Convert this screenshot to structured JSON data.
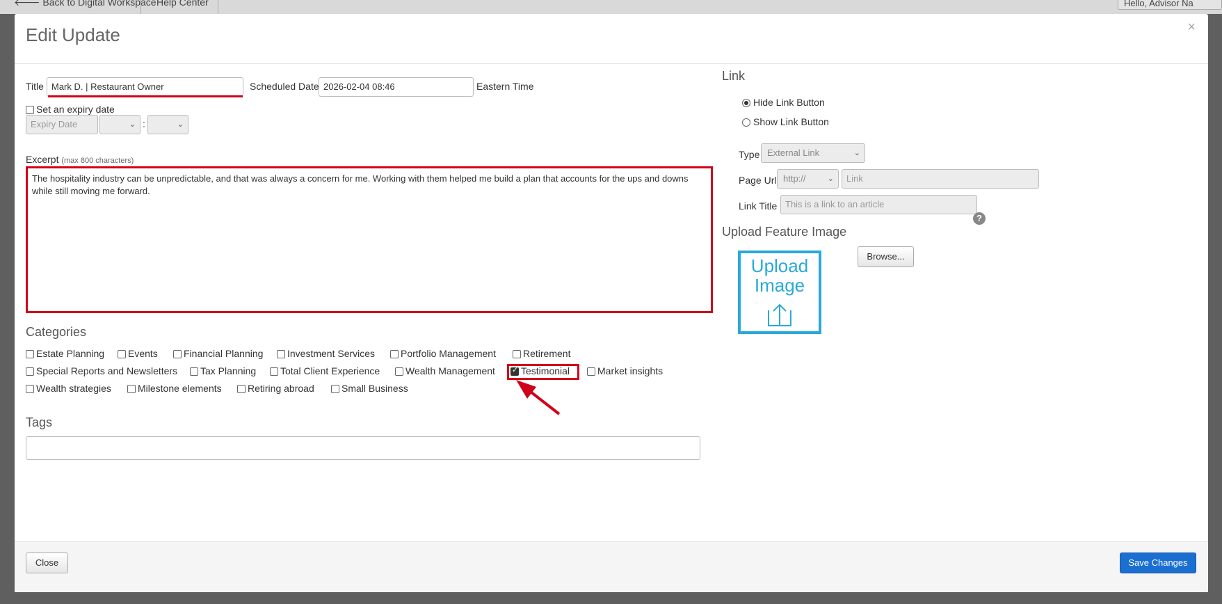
{
  "background": {
    "back_link": "🡐 Back to Digital Workspace",
    "help_center": "Help Center",
    "hello": "Hello, Advisor Na"
  },
  "modal": {
    "title": "Edit Update",
    "close_symbol": "×"
  },
  "form": {
    "title_label": "Title",
    "title_value": "Mark D. | Restaurant Owner",
    "scheduled_label": "Scheduled Date",
    "scheduled_value": "2026-02-04 08:46",
    "timezone": "Eastern Time",
    "expiry_checkbox_label": "Set an expiry date",
    "expiry_placeholder": "Expiry Date",
    "time_separator": ":",
    "excerpt_label": "Excerpt",
    "excerpt_hint": "(max 800 characters)",
    "excerpt_text": "The hospitality industry can be unpredictable, and that was always a concern for me. Working with them helped me build a plan that accounts for the ups and downs while still moving me forward."
  },
  "categories": {
    "title": "Categories",
    "items": [
      {
        "label": "Estate Planning",
        "checked": false
      },
      {
        "label": "Events",
        "checked": false
      },
      {
        "label": "Financial Planning",
        "checked": false
      },
      {
        "label": "Investment Services",
        "checked": false
      },
      {
        "label": "Portfolio Management",
        "checked": false
      },
      {
        "label": "Retirement",
        "checked": false
      },
      {
        "label": "Special Reports and Newsletters",
        "checked": false
      },
      {
        "label": "Tax Planning",
        "checked": false
      },
      {
        "label": "Total Client Experience",
        "checked": false
      },
      {
        "label": "Wealth Management",
        "checked": false
      },
      {
        "label": "Testimonial",
        "checked": true
      },
      {
        "label": "Market insights",
        "checked": false
      },
      {
        "label": "Wealth strategies",
        "checked": false
      },
      {
        "label": "Milestone elements",
        "checked": false
      },
      {
        "label": "Retiring abroad",
        "checked": false
      },
      {
        "label": "Small Business",
        "checked": false
      }
    ]
  },
  "tags": {
    "title": "Tags"
  },
  "link": {
    "title": "Link",
    "hide_label": "Hide Link Button",
    "show_label": "Show Link Button",
    "selected": "hide",
    "type_label": "Type",
    "type_value": "External Link",
    "page_url_label": "Page Url",
    "protocol_value": "http://",
    "link_placeholder": "Link",
    "link_title_label": "Link Title",
    "link_title_placeholder": "This is a link to an article",
    "help_symbol": "?"
  },
  "upload": {
    "title": "Upload Feature Image",
    "box_text": "Upload Image",
    "browse_label": "Browse..."
  },
  "footer": {
    "close_label": "Close",
    "save_label": "Save Changes"
  },
  "colors": {
    "highlight_red": "#d0021b",
    "primary_blue": "#1b6fd1",
    "upload_blue": "#2aa9d8"
  }
}
